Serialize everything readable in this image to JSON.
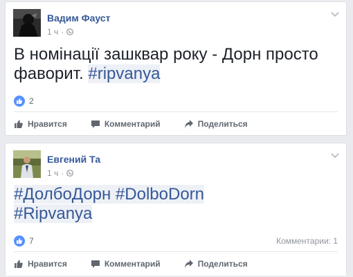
{
  "posts": [
    {
      "author": "Вадим Фауст",
      "time": "1 ч",
      "separator": "·",
      "text_plain": "В номінації зашквар року - Дорн просто фаворит.",
      "hashtag": "#ripvanya",
      "likes": "2",
      "comments": "",
      "actions": {
        "like": "Нравится",
        "comment": "Комментарий",
        "share": "Поделиться"
      }
    },
    {
      "author": "Евгений Та",
      "time": "1 ч",
      "separator": "·",
      "hashtags_line1": "#ДолбоДорн #DolboDorn",
      "hashtag_line2": "#Ripvanya",
      "likes": "7",
      "comments": "Комментарии: 1",
      "actions": {
        "like": "Нравится",
        "comment": "Комментарий",
        "share": "Поделиться"
      }
    }
  ],
  "colors": {
    "link": "#365899",
    "meta": "#90949c",
    "like": "#5890ff",
    "background": "#e9ebee"
  },
  "icons": [
    "globe-icon",
    "chevron-down-icon",
    "like-icon",
    "thumb-icon",
    "comment-icon",
    "share-icon"
  ]
}
